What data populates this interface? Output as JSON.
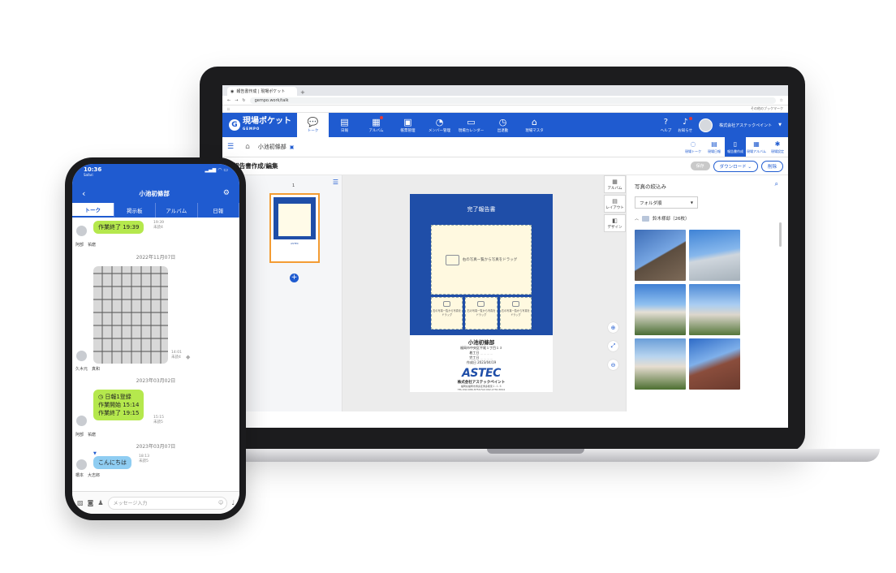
{
  "browser": {
    "tab_title": "報告書作成 | 現場ポケット",
    "url": "gempo.work/talk",
    "bookmarks_right": "その他のブックマーク"
  },
  "app": {
    "logo": "現場ポケット",
    "logo_sub": "GEMPO",
    "nav": [
      {
        "label": "トーク",
        "icon": "chat-icon",
        "glyph": "💬",
        "active": true
      },
      {
        "label": "日報",
        "icon": "report-icon",
        "glyph": "▤"
      },
      {
        "label": "アルバム",
        "icon": "album-icon",
        "glyph": "▦",
        "badge": true
      },
      {
        "label": "帳票管理",
        "icon": "calculator-icon",
        "glyph": "▣"
      },
      {
        "label": "メンバー管理",
        "icon": "member-icon",
        "glyph": "◔"
      },
      {
        "label": "現場カレンダー",
        "icon": "calendar-icon",
        "glyph": "▭"
      },
      {
        "label": "出退勤",
        "icon": "clock-icon",
        "glyph": "◷"
      },
      {
        "label": "現場マスタ",
        "icon": "house-icon",
        "glyph": "⌂"
      }
    ],
    "help_label": "ヘルプ",
    "notice_label": "お知らせ",
    "company": "株式会社アステックペイント"
  },
  "site": {
    "name": "小池初條部",
    "tools": [
      {
        "label": "現場トーク",
        "glyph": "◌"
      },
      {
        "label": "現場日報",
        "glyph": "▤"
      },
      {
        "label": "報告書作成",
        "glyph": "▯",
        "active": true
      },
      {
        "label": "現場アルバム",
        "glyph": "▦"
      },
      {
        "label": "現場設定",
        "glyph": "✱"
      }
    ]
  },
  "editor": {
    "title": "報告書作成/編集",
    "save": "保存",
    "download": "ダウンロード",
    "delete": "削除",
    "page_number": "1",
    "side_tools": [
      "アルバム",
      "レイアウト",
      "デザイン"
    ]
  },
  "sheet": {
    "title": "完了報告書",
    "main_photo_hint": "右の写真一覧から写真をドラッグ",
    "small_photo_hint": "右の写真一覧から写真をドラッグ",
    "site_name": "小池初條部",
    "address": "福岡市中央区平尾１丁目１３",
    "start_label": "着工日",
    "end_label": "完工日",
    "created_label": "作成日",
    "created_date": "2023/04/19",
    "brand": "ASTEC",
    "company": "株式会社アステックペイント",
    "company_address": "福岡県福岡市博多区博多駅東１-１-６",
    "contact": "TEL:092-686-8756 FAX:092-2730-5844"
  },
  "photos": {
    "title": "写真の絞込み",
    "sort": "フォルダ順",
    "folder": "鈴木様邸（26枚）"
  },
  "phone": {
    "time": "10:36",
    "carrier": "Safari",
    "chat_name": "小池初條部",
    "tabs": [
      "トーク",
      "掲示板",
      "アルバム",
      "日報"
    ],
    "messages": [
      {
        "text": "作業終了 19:39",
        "time": "19:39",
        "read": "未読4",
        "sender": "阿部　祐磨"
      },
      {
        "date": "2022年11月07日"
      },
      {
        "time": "14:01",
        "read": "未読4",
        "sender": "久木元　真和"
      },
      {
        "date": "2023年03月02日"
      },
      {
        "title": "日報1登録",
        "line1": "作業開始 15:14",
        "line2": "作業終了 19:15",
        "time": "15:15",
        "read": "未読5",
        "sender": "阿部　祐磨"
      },
      {
        "date": "2023年03月07日"
      },
      {
        "text": "こんにちは",
        "time": "18:13",
        "read": "未読5",
        "sender": "橋本　大志郎"
      }
    ],
    "input_placeholder": "メッセージ入力"
  }
}
